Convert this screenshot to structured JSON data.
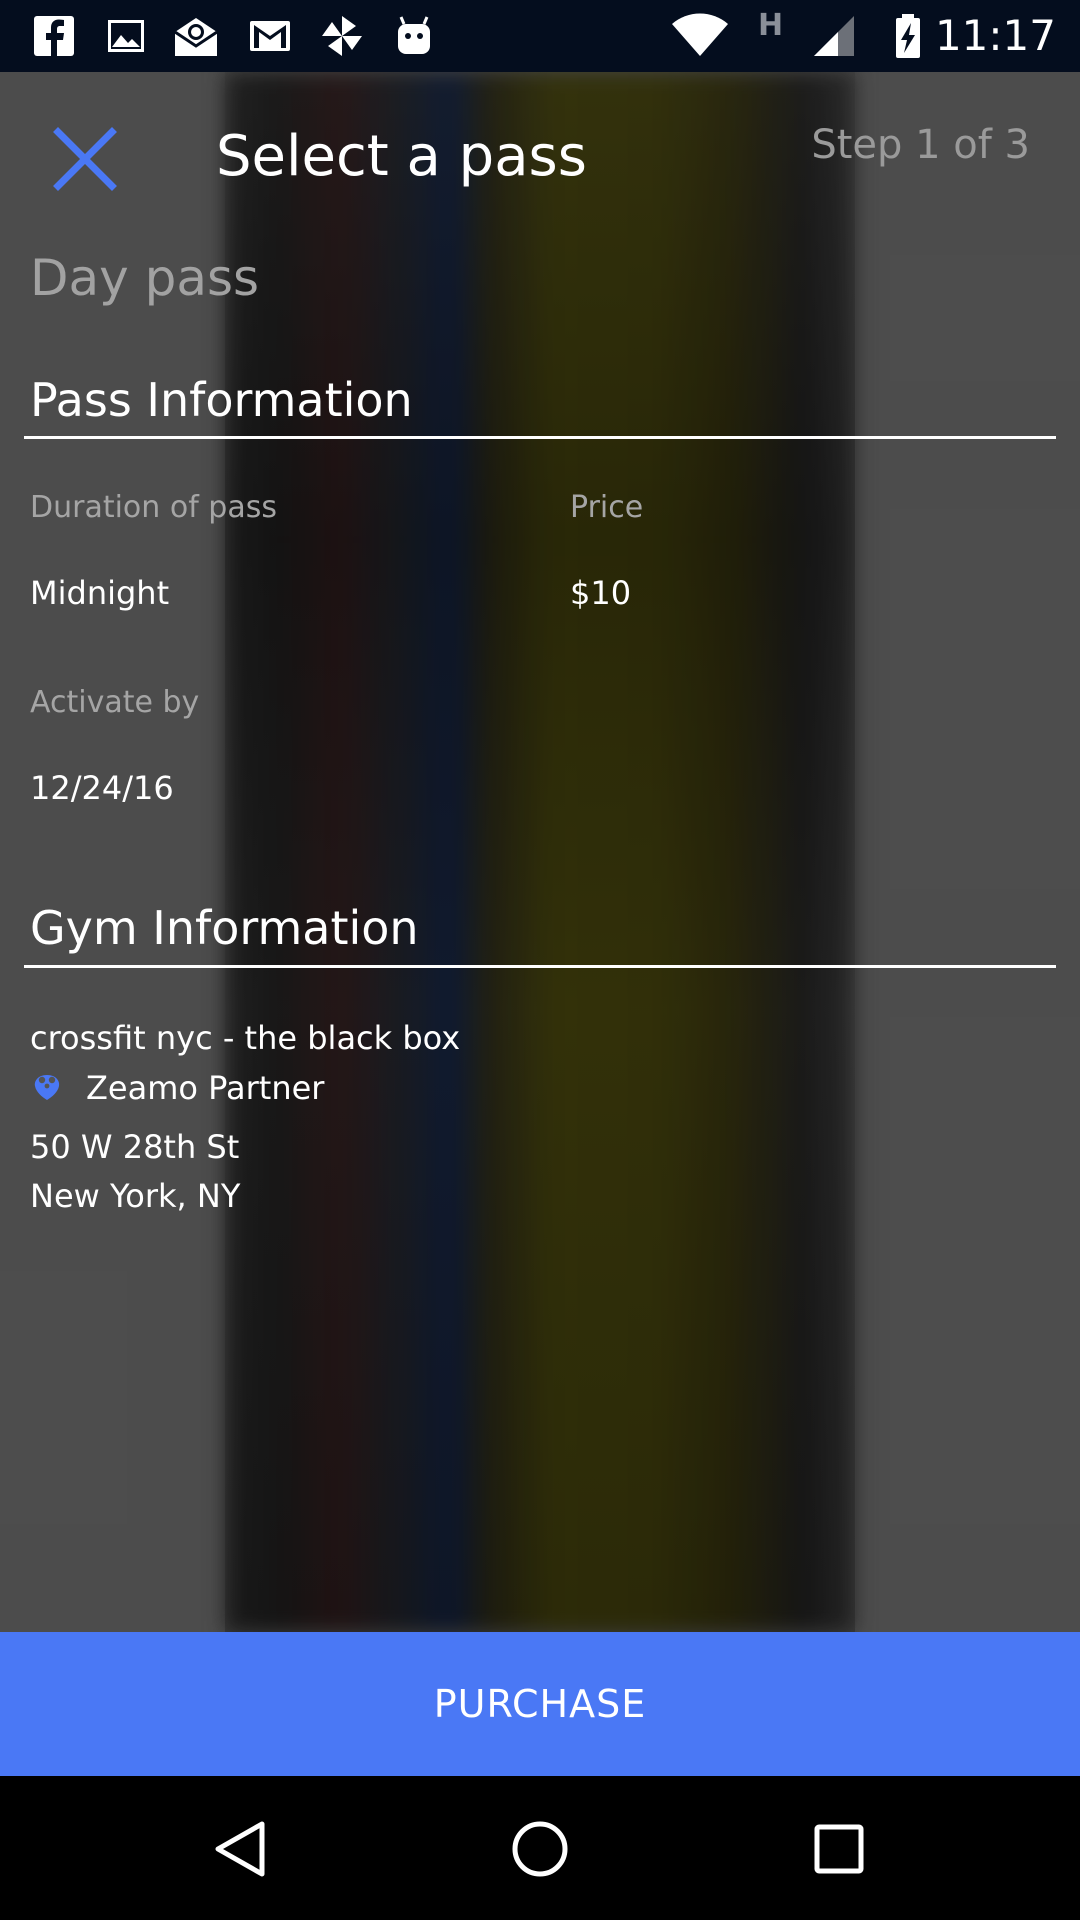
{
  "status_bar": {
    "time": "11:17",
    "network_label": "H",
    "notification_icons": [
      "facebook-icon",
      "gallery-icon",
      "email-app-icon",
      "gmail-icon",
      "pinwheel-icon",
      "android-bot-icon"
    ],
    "system_icons": [
      "wifi-icon",
      "signal-icon",
      "battery-charging-icon"
    ]
  },
  "header": {
    "close_icon": "close-icon",
    "title": "Select a pass",
    "step": "Step 1 of 3"
  },
  "pass": {
    "type": "Day pass",
    "section_title": "Pass Information",
    "duration_label": "Duration of pass",
    "duration_value": "Midnight",
    "price_label": "Price",
    "price_value": "$10",
    "activate_label": "Activate by",
    "activate_value": "12/24/16"
  },
  "gym": {
    "section_title": "Gym Information",
    "name": "crossfit nyc - the black box",
    "partner_label": "Zeamo Partner",
    "address_line1": "50 W 28th St",
    "address_line2": "New York, NY"
  },
  "purchase_label": "PURCHASE",
  "nav_bar": {
    "icons": [
      "back-icon",
      "home-icon",
      "recents-icon"
    ]
  },
  "colors": {
    "accent": "#4a78f5",
    "status_bar_bg": "#040d1e",
    "content_bg": "#555555",
    "muted_text": "#a5a5a5"
  }
}
